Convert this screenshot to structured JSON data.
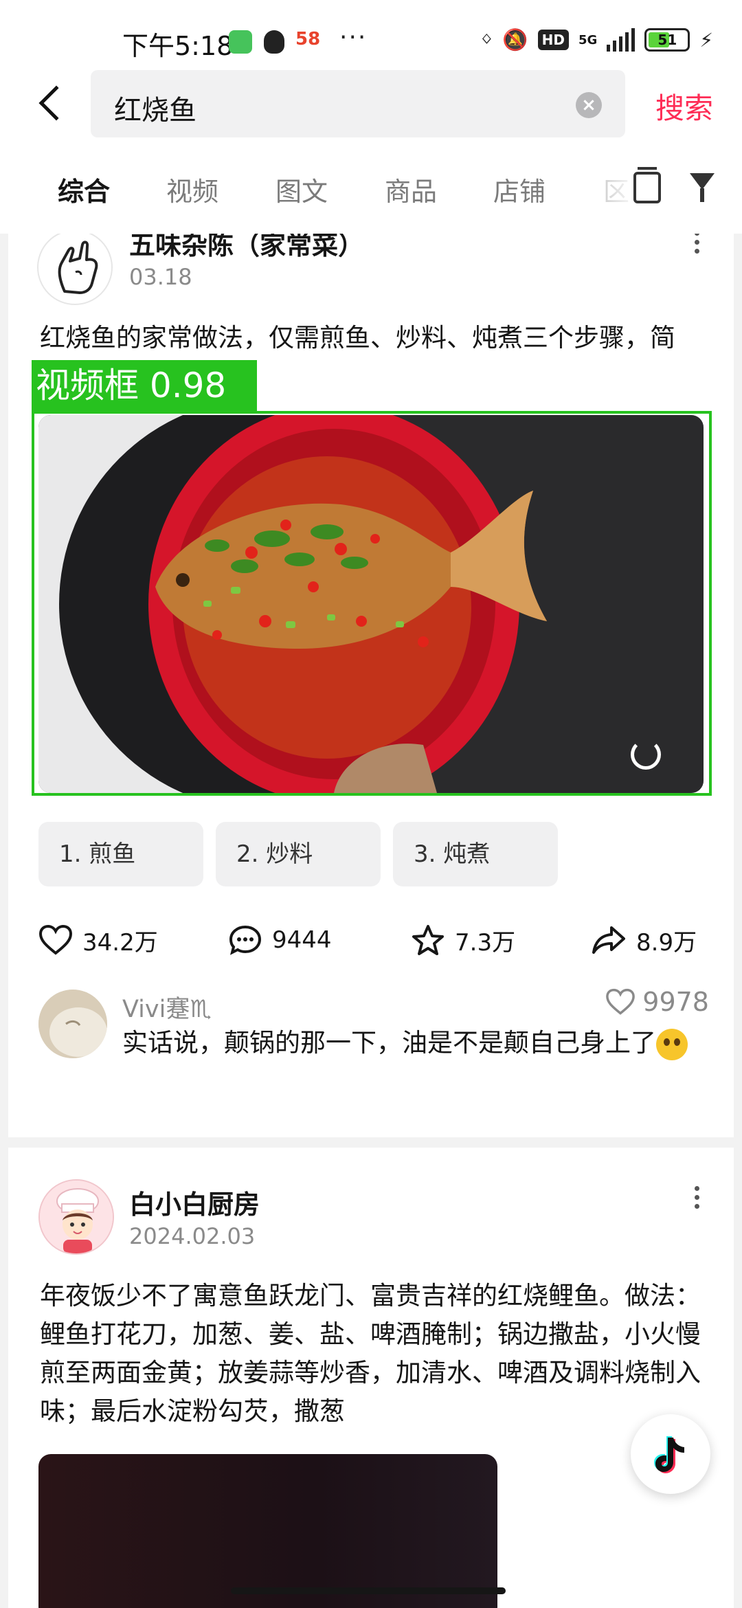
{
  "status_bar": {
    "time": "下午5:18",
    "apps": [
      "wechat-icon",
      "qq-icon",
      "58-app-icon"
    ],
    "app_58_label": "58",
    "more": "···",
    "network": "5G",
    "hd_label": "HD",
    "battery": "51"
  },
  "search": {
    "query": "红烧鱼",
    "submit_label": "搜索"
  },
  "tabs": [
    {
      "label": "综合",
      "active": true
    },
    {
      "label": "视频"
    },
    {
      "label": "图文"
    },
    {
      "label": "商品"
    },
    {
      "label": "店铺"
    },
    {
      "label": "区"
    }
  ],
  "post1": {
    "author": "五味杂陈（家常菜）",
    "date": "03.18",
    "text": "红烧鱼的家常做法，仅需煎鱼、炒料、炖煮三个步骤，简单，小白也能学会!",
    "detection_label": "视频框 0.98",
    "chapters": [
      "1. 煎鱼",
      "2. 炒料",
      "3. 炖煮"
    ],
    "likes": "34.2万",
    "comments": "9444",
    "favorites": "7.3万",
    "shares": "8.9万",
    "top_comment": {
      "user": "Vivi蹇♏",
      "likes": "9978",
      "text": "实话说，颠锅的那一下，油是不是颠自己身上了"
    }
  },
  "post2": {
    "author": "白小白厨房",
    "date": "2024.02.03",
    "text": "年夜饭少不了寓意鱼跃龙门、富贵吉祥的红烧鲤鱼。做法：鲤鱼打花刀，加葱、姜、盐、啤酒腌制；锅边撒盐，小火慢煎至两面金黄；放姜蒜等炒香，加清水、啤酒及调料烧制入味；最后水淀粉勾芡，撒葱"
  },
  "colors": {
    "accent": "#fe2c55",
    "detection_green": "#27c21f",
    "dish_red": "#d5152a",
    "fish_brown": "#c07a35"
  }
}
